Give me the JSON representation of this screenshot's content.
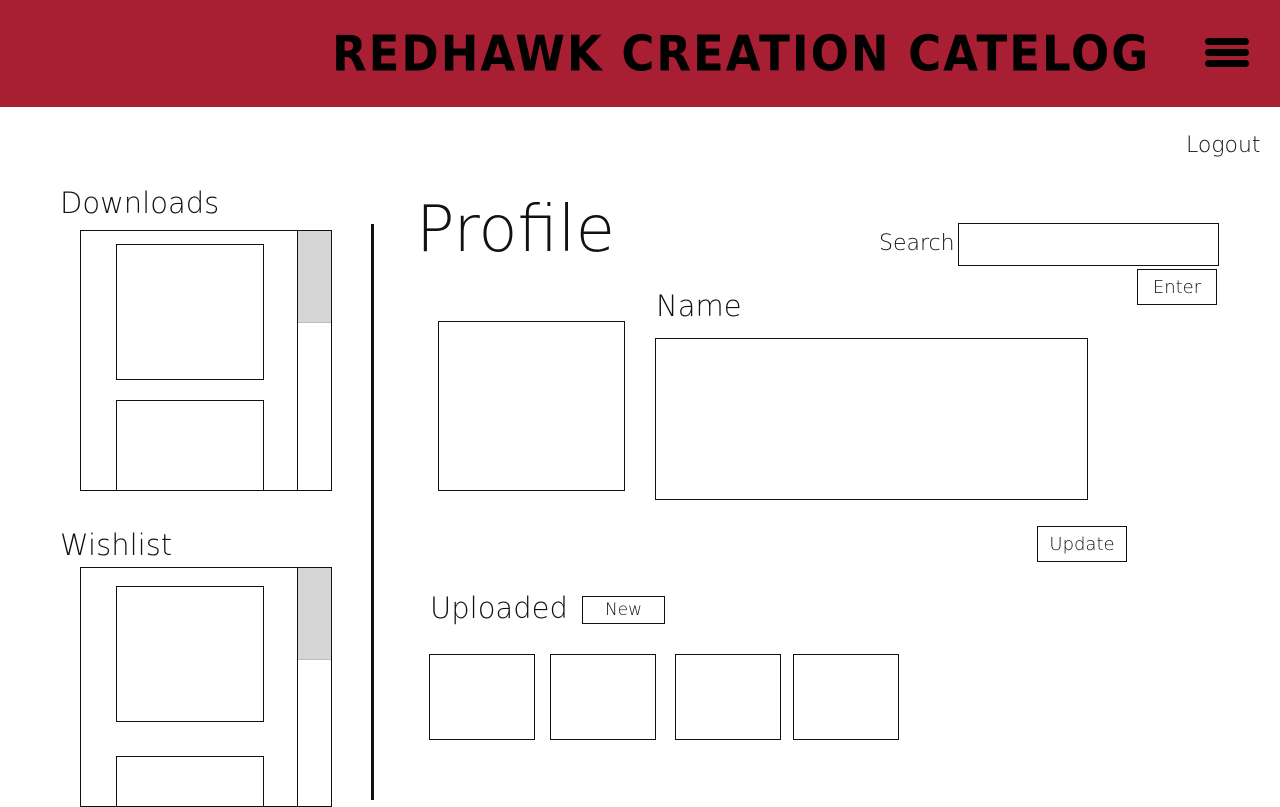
{
  "header": {
    "brand": "REDHAWK CREATION CATELOG",
    "background_color": "#a81e32",
    "menu_icon": "hamburger-menu-icon"
  },
  "nav": {
    "logout_label": "Logout"
  },
  "sidebar": {
    "downloads": {
      "title": "Downloads"
    },
    "wishlist": {
      "title": "Wishlist"
    }
  },
  "main": {
    "title": "Profile",
    "search": {
      "label": "Search",
      "value": "",
      "enter_label": "Enter"
    },
    "name": {
      "label": "Name",
      "value": ""
    },
    "update_label": "Update",
    "uploaded": {
      "title": "Uploaded",
      "new_label": "New"
    }
  }
}
